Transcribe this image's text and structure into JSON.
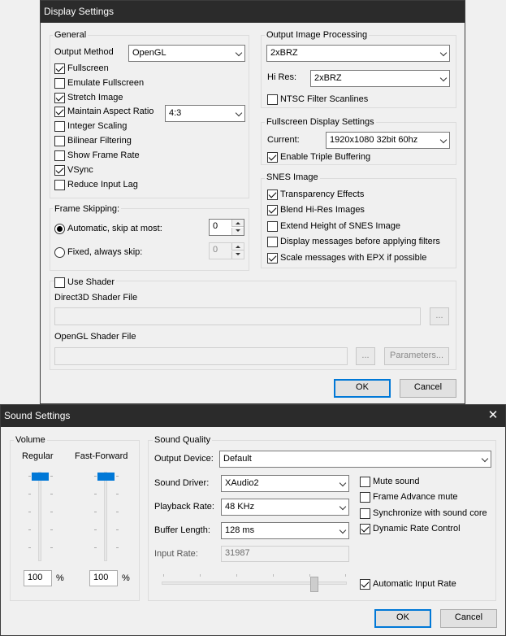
{
  "display": {
    "title": "Display Settings",
    "general": {
      "label": "General",
      "output_method_label": "Output Method",
      "output_method_value": "OpenGL",
      "fullscreen": "Fullscreen",
      "emulate_fullscreen": "Emulate Fullscreen",
      "stretch_image": "Stretch Image",
      "maintain_aspect": "Maintain Aspect Ratio",
      "aspect_value": "4:3",
      "integer_scaling": "Integer Scaling",
      "bilinear": "Bilinear Filtering",
      "show_frame_rate": "Show Frame Rate",
      "vsync": "VSync",
      "reduce_input_lag": "Reduce Input Lag"
    },
    "frame_skipping": {
      "label": "Frame Skipping:",
      "automatic": "Automatic, skip at most:",
      "automatic_value": "0",
      "fixed": "Fixed, always skip:",
      "fixed_value": "0"
    },
    "output_processing": {
      "label": "Output Image Processing",
      "filter_value": "2xBRZ",
      "hires_label": "Hi Res:",
      "hires_value": "2xBRZ",
      "ntsc": "NTSC Filter Scanlines"
    },
    "fullscreen_settings": {
      "label": "Fullscreen Display Settings",
      "current_label": "Current:",
      "current_value": "1920x1080 32bit 60hz",
      "triple_buffering": "Enable Triple Buffering"
    },
    "snes_image": {
      "label": "SNES Image",
      "transparency": "Transparency Effects",
      "blend_hires": "Blend Hi-Res Images",
      "extend_height": "Extend Height of SNES Image",
      "display_messages": "Display messages before applying filters",
      "scale_messages": "Scale messages with EPX if possible"
    },
    "shader": {
      "use_shader": "Use Shader",
      "d3d_label": "Direct3D Shader File",
      "opengl_label": "OpenGL Shader File",
      "browse": "...",
      "parameters": "Parameters..."
    },
    "ok": "OK",
    "cancel": "Cancel"
  },
  "sound": {
    "title": "Sound Settings",
    "close": "✕",
    "volume": {
      "label": "Volume",
      "regular": "Regular",
      "fast_forward": "Fast-Forward",
      "regular_value": "100",
      "ff_value": "100",
      "percent": "%"
    },
    "quality": {
      "label": "Sound Quality",
      "output_device_label": "Output Device:",
      "output_device_value": "Default",
      "driver_label": "Sound Driver:",
      "driver_value": "XAudio2",
      "playback_label": "Playback Rate:",
      "playback_value": "48 KHz",
      "buffer_label": "Buffer Length:",
      "buffer_value": "128 ms",
      "input_rate_label": "Input Rate:",
      "input_rate_value": "31987",
      "mute": "Mute sound",
      "frame_advance_mute": "Frame Advance mute",
      "sync": "Synchronize with sound core",
      "dynamic_rate": "Dynamic Rate Control",
      "auto_input_rate": "Automatic Input Rate"
    },
    "ok": "OK",
    "cancel": "Cancel"
  }
}
